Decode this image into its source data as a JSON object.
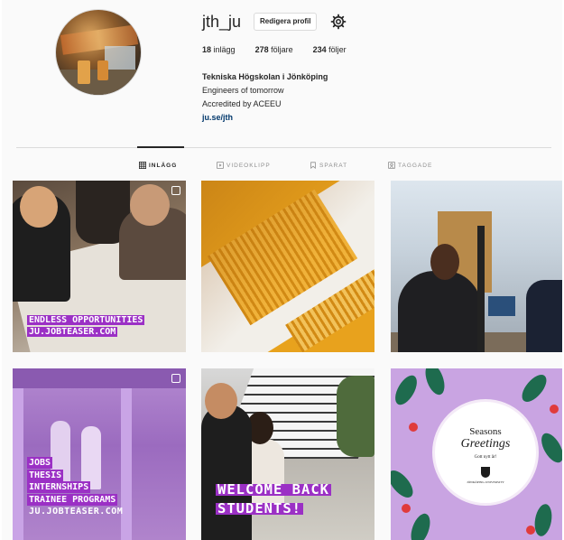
{
  "profile": {
    "username": "jth_ju",
    "edit_profile_label": "Redigera profil",
    "stats": {
      "posts_count": "18",
      "posts_label": "inlägg",
      "followers_count": "278",
      "followers_label": "följare",
      "following_count": "234",
      "following_label": "följer"
    },
    "bio": {
      "name": "Tekniska Högskolan i Jönköping",
      "line1": "Engineers of tomorrow",
      "line2": "Accredited by ACEEU",
      "link": "ju.se/jth"
    }
  },
  "tabs": [
    {
      "label": "INLÄGG",
      "icon": "grid-icon",
      "active": true
    },
    {
      "label": "VIDEOKLIPP",
      "icon": "video-icon",
      "active": false
    },
    {
      "label": "SPARAT",
      "icon": "bookmark-icon",
      "active": false
    },
    {
      "label": "TAGGADE",
      "icon": "tag-icon",
      "active": false
    }
  ],
  "posts": [
    {
      "caption_lines": [
        "ENDLESS OPPORTUNITIES",
        "JU.JOBTEASER.COM"
      ],
      "multi": true
    },
    {
      "caption_lines": [],
      "multi": false
    },
    {
      "caption_lines": [],
      "multi": false
    },
    {
      "caption_lines": [
        "JOBS",
        "THESIS",
        "INTERNSHIPS",
        "TRAINEE PROGRAMS",
        "JU.JOBTEASER.COM"
      ],
      "multi": true
    },
    {
      "caption_lines": [
        "WELCOME BACK",
        "STUDENTS!"
      ],
      "multi": false
    },
    {
      "greeting": {
        "line1": "Seasons",
        "line2": "Greetings",
        "line3": "Gott nytt år!",
        "org": "JÖNKÖPING UNIVERSITY"
      },
      "multi": false
    }
  ],
  "colors": {
    "caption_highlight": "#9b30c5",
    "link": "#00376b",
    "background": "#fafafa"
  }
}
